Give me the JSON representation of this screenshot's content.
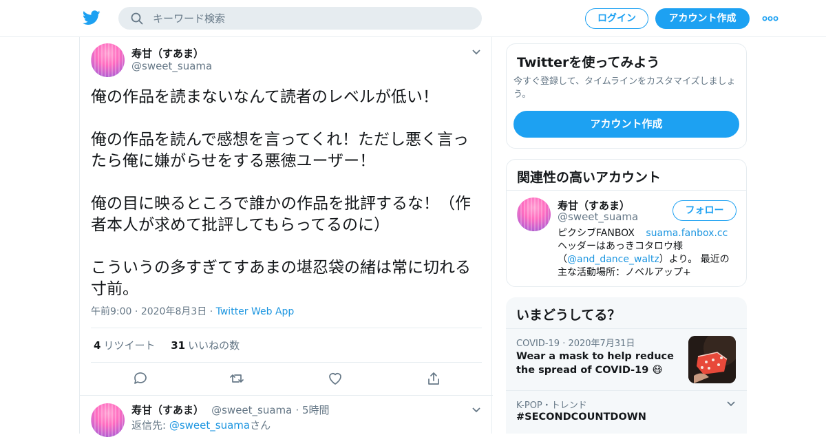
{
  "topbar": {
    "search_placeholder": "キーワード検索",
    "login_label": "ログイン",
    "signup_label": "アカウント作成"
  },
  "tweet": {
    "author_name": "寿甘（すあま）",
    "author_handle": "@sweet_suama",
    "paragraphs": [
      "俺の作品を読まないなんて読者のレベルが低い！",
      "俺の作品を読んで感想を言ってくれ！ただし悪く言ったら俺に嫌がらせをする悪徳ユーザー！",
      "俺の目に映るところで誰かの作品を批評するな！（作者本人が求めて批評してもらってるのに）",
      "こういうの多すぎてすあまの堪忍袋の緒は常に切れる寸前。"
    ],
    "time": "午前9:00",
    "date": "2020年8月3日",
    "source": "Twitter Web App",
    "retweet_count": "4",
    "retweet_label": "リツイート",
    "like_count": "31",
    "like_label": "いいねの数"
  },
  "reply": {
    "author_name": "寿甘（すあま）",
    "author_handle": "@sweet_suama",
    "time_ago": "5時間",
    "reply_to_prefix": "返信先: ",
    "reply_to_handle": "@sweet_suama",
    "reply_to_suffix": "さん"
  },
  "signup_card": {
    "title": "Twitterを使ってみよう",
    "description": "今すぐ登録して、タイムラインをカスタマイズしましょう。",
    "button_label": "アカウント作成"
  },
  "related_card": {
    "title": "関連性の高いアカウント",
    "name": "寿甘（すあま）",
    "handle": "@sweet_suama",
    "follow_label": "フォロー",
    "bio_line1": "ピクシブFANBOX",
    "bio_link": "suama.fanbox.cc",
    "bio_line2_pre": "ヘッダーはあっきコタロウ様（",
    "bio_mention": "@and_dance_waltz",
    "bio_line2_post": "）より。 最近の主な活動場所：ノベルアップ+"
  },
  "trends_card": {
    "title": "いまどうしてる？",
    "item1_category": "COVID-19",
    "item1_date": "2020年7月31日",
    "item1_text": "Wear a mask to help reduce the spread of COVID-19 😷",
    "item2_category": "K-POP・トレンド",
    "item2_text": "#SECONDCOUNTDOWN"
  },
  "colors": {
    "brand": "#1da1f2",
    "link": "#1b95e0",
    "muted": "#657786"
  }
}
